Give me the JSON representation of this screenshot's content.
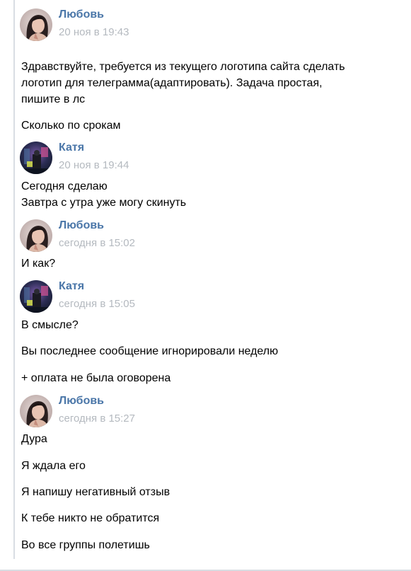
{
  "colors": {
    "author_link": "#4a76a8",
    "timestamp": "#b4b9bf",
    "rule": "#d9dde3"
  },
  "icons": {
    "lyubov_avatar": "woman-portrait-photo",
    "katya_avatar": "night-street-photo"
  },
  "messages": [
    {
      "author": "Любовь",
      "time": "20 ноя в 19:43",
      "lines": [
        "Здравствуйте, требуется из текущего логотипа сайта сделать",
        "логотип для телеграмма(адаптировать). Задача простая,",
        "пишите в лс",
        "Сколько по срокам"
      ]
    },
    {
      "author": "Катя",
      "time": "20 ноя в 19:44",
      "lines": [
        "Сегодня сделаю",
        "Завтра с утра уже могу скинуть"
      ]
    },
    {
      "author": "Любовь",
      "time": "сегодня в 15:02",
      "lines": [
        "И как?"
      ]
    },
    {
      "author": "Катя",
      "time": "сегодня в 15:05",
      "lines": [
        "В смысле?",
        "Вы последнее сообщение игнорировали неделю",
        "+ оплата не была оговорена"
      ]
    },
    {
      "author": "Любовь",
      "time": "сегодня в 15:27",
      "lines": [
        "Дура",
        "Я ждала его",
        "Я напишу негативный отзыв",
        "К тебе никто не обратится",
        "Во все группы полетишь"
      ]
    }
  ]
}
